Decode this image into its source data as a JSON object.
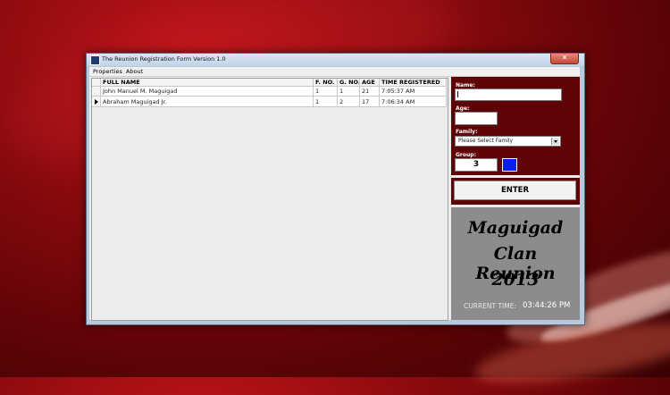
{
  "window": {
    "title": "The Reunion Registration Form Version 1.0",
    "close_glyph": "✕"
  },
  "menu": {
    "items": [
      "Properties",
      "About"
    ]
  },
  "grid": {
    "columns": [
      "FULL NAME",
      "F. NO.",
      "G. NO.",
      "AGE",
      "TIME REGISTERED"
    ],
    "rows": [
      {
        "full_name": "John Manuel M. Maguigad",
        "f_no": "1",
        "g_no": "1",
        "age": "21",
        "time": "7:05:37 AM",
        "current": false
      },
      {
        "full_name": "Abraham Maguigad Jr.",
        "f_no": "1",
        "g_no": "2",
        "age": "17",
        "time": "7:06:34 AM",
        "current": true
      }
    ]
  },
  "form": {
    "name_label": "Name:",
    "name_value": "",
    "age_label": "Age:",
    "age_value": "",
    "family_label": "Family:",
    "family_selected": "Please Select Family",
    "group_label": "Group:",
    "group_value": "3",
    "group_color": "#0a1cf5",
    "enter_label": "ENTER"
  },
  "banner": {
    "lines": [
      "Maguigad",
      "Clan Reunion",
      "2013"
    ],
    "clock_label": "CURRENT TIME:",
    "clock_value": "03:44:26 PM"
  },
  "colors": {
    "panel_bg": "#5e0306",
    "banner_bg": "#8c8c8c",
    "desktop_red": "#8a0a0e"
  }
}
